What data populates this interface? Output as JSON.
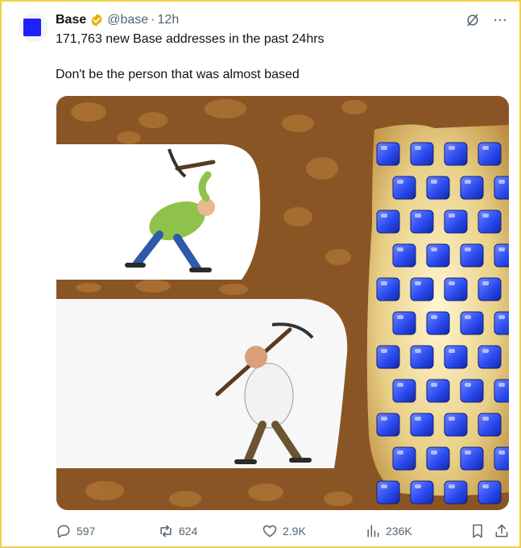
{
  "post": {
    "author_name": "Base",
    "handle": "@base",
    "separator": "·",
    "time": "12h",
    "text_line1": "171,763 new Base addresses in the past 24hrs",
    "text_line2": "Don't be the person that was almost based"
  },
  "icons": {
    "avatar": "blue-square-logo",
    "verified": "gold-verified-badge-icon",
    "grok": "grok-slash-icon",
    "more": "more-dots-icon",
    "reply": "reply-bubble-icon",
    "repost": "repost-arrows-icon",
    "like": "heart-icon",
    "views": "views-bars-icon",
    "bookmark": "bookmark-icon",
    "share": "share-upload-icon"
  },
  "actions": {
    "replies": "597",
    "reposts": "624",
    "likes": "2.9K",
    "views": "236K"
  },
  "colors": {
    "brand_blue": "#1f1fff",
    "badge_gold": "#e8b308",
    "muted": "#536471",
    "frame": "#f2d04a",
    "dirt": "#8a5525",
    "gem": "#2b4bf0"
  }
}
